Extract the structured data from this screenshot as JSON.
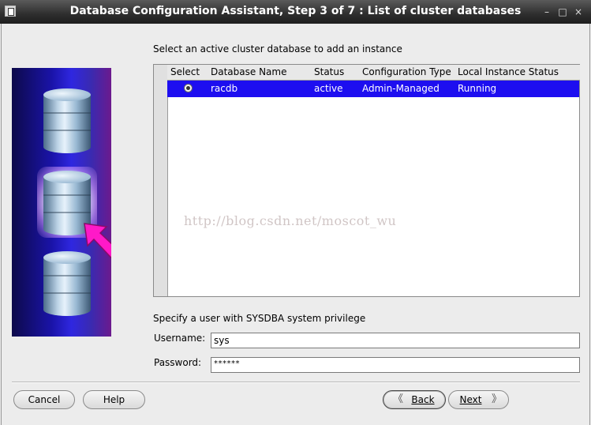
{
  "window": {
    "title": "Database Configuration Assistant, Step 3 of 7 : List of cluster databases",
    "controls": [
      "–",
      "□",
      "×"
    ]
  },
  "main": {
    "instruction": "Select an active cluster database to add an instance",
    "table": {
      "columns": [
        "Select",
        "Database Name",
        "Status",
        "Configuration Type",
        "Local Instance Status"
      ],
      "rows": [
        {
          "selected": true,
          "database_name": "racdb",
          "status": "active",
          "configuration_type": "Admin-Managed",
          "local_instance_status": "Running"
        }
      ]
    },
    "watermark": "http://blog.csdn.net/moscot_wu",
    "sysdba_prompt": "Specify a user with SYSDBA system privilege",
    "username": {
      "label": "Username:",
      "value": "sys"
    },
    "password": {
      "label": "Password:",
      "value": "******"
    }
  },
  "footer": {
    "cancel": "Cancel",
    "help": "Help",
    "back": "Back",
    "next": "Next"
  },
  "colors": {
    "selection": "#1d0ef0",
    "titlebar": "#2e2e2e",
    "arrow": "#ff19c8"
  }
}
